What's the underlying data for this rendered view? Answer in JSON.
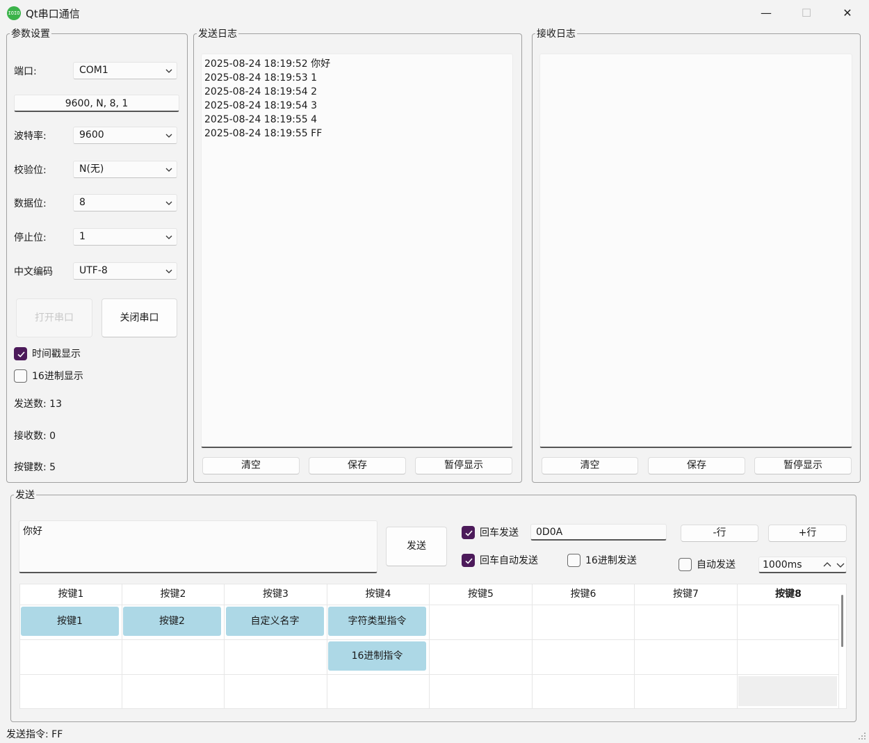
{
  "window": {
    "title": "Qt串口通信",
    "icon_text": "IOIO",
    "minimize": "—",
    "maximize": "☐",
    "close": "✕"
  },
  "params": {
    "legend": "参数设置",
    "port_label": "端口:",
    "port_value": "COM1",
    "summary": "9600, N, 8, 1",
    "baud_label": "波特率:",
    "baud_value": "9600",
    "parity_label": "校验位:",
    "parity_value": "N(无)",
    "databits_label": "数据位:",
    "databits_value": "8",
    "stopbits_label": "停止位:",
    "stopbits_value": "1",
    "encoding_label": "中文编码",
    "encoding_value": "UTF-8",
    "open_button": "打开串口",
    "close_button": "关闭串口",
    "timestamp_label": "时间戳显示",
    "timestamp_checked": true,
    "hexdisplay_label": "16进制显示",
    "hexdisplay_checked": false,
    "sent_count": "发送数: 13",
    "recv_count": "接收数: 0",
    "key_count": "按键数: 5"
  },
  "send_log": {
    "legend": "发送日志",
    "lines": [
      "2025-08-24 18:19:52 你好",
      "2025-08-24 18:19:53 1",
      "2025-08-24 18:19:54 2",
      "2025-08-24 18:19:54 3",
      "2025-08-24 18:19:55 4",
      "2025-08-24 18:19:55 FF"
    ],
    "clear": "清空",
    "save": "保存",
    "pause": "暂停显示"
  },
  "recv_log": {
    "legend": "接收日志",
    "clear": "清空",
    "save": "保存",
    "pause": "暂停显示"
  },
  "send": {
    "legend": "发送",
    "text": "你好",
    "send_button": "发送",
    "enter_send_label": "回车发送",
    "enter_send_checked": true,
    "terminator_value": "0D0A",
    "enter_auto_label": "回车自动发送",
    "enter_auto_checked": true,
    "hex_send_label": "16进制发送",
    "hex_send_checked": false,
    "remove_row": "-行",
    "add_row": "+行",
    "auto_send_label": "自动发送",
    "auto_send_checked": false,
    "interval_value": "1000ms"
  },
  "grid": {
    "headers": [
      "按键1",
      "按键2",
      "按键3",
      "按键4",
      "按键5",
      "按键6",
      "按键7",
      "按键8"
    ],
    "row1": [
      "按键1",
      "按键2",
      "自定义名字",
      "字符类型指令"
    ],
    "row2": [
      "16进制指令"
    ]
  },
  "status": {
    "text": "发送指令: FF"
  },
  "colors": {
    "accent": "#4c1a5a",
    "cell_button": "#add8e6",
    "app_icon": "#3bb34a"
  }
}
